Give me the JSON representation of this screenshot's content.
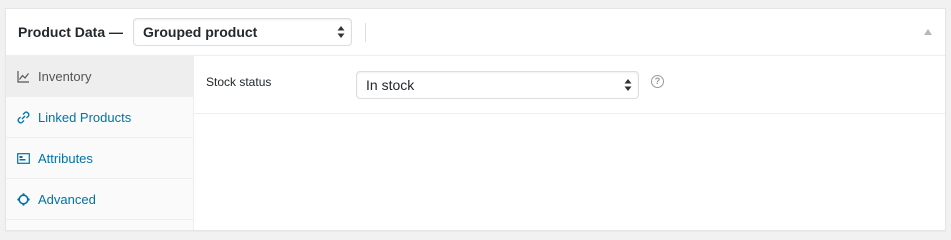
{
  "header": {
    "title": "Product Data —",
    "product_type": "Grouped product",
    "toggle_icon": "triangle-up-icon"
  },
  "tabs": [
    {
      "label": "Inventory",
      "icon": "chart-line-icon",
      "active": true
    },
    {
      "label": "Linked Products",
      "icon": "link-icon",
      "active": false
    },
    {
      "label": "Attributes",
      "icon": "list-icon",
      "active": false
    },
    {
      "label": "Advanced",
      "icon": "gear-icon",
      "active": false
    }
  ],
  "inventory": {
    "stock_status_label": "Stock status",
    "stock_status_value": "In stock",
    "help_glyph": "?"
  },
  "colors": {
    "link": "#0073aa",
    "active_tab_bg": "#eeeeee",
    "tabs_bg": "#fafafa"
  }
}
